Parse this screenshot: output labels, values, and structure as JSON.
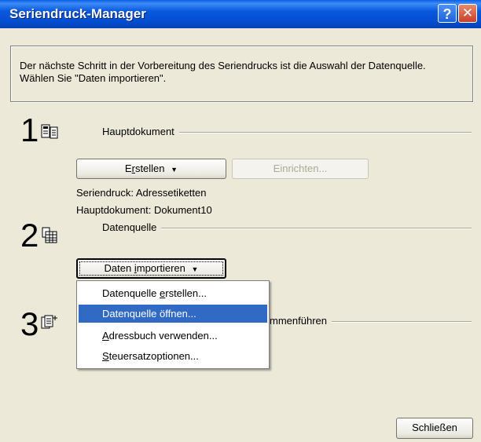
{
  "window": {
    "title": "Seriendruck-Manager",
    "help_glyph": "?",
    "close_glyph": "✕"
  },
  "instructions": "Der nächste Schritt in der Vorbereitung des Seriendrucks ist die Auswahl der Datenquelle. Wählen Sie \"Daten importieren\".",
  "steps": [
    {
      "number": "1",
      "icon": "main-document-icon",
      "label": "Hauptdokument"
    },
    {
      "number": "2",
      "icon": "data-source-icon",
      "label": "Datenquelle"
    },
    {
      "number": "3",
      "icon": "merge-icon",
      "label_partial": "mmenführen"
    }
  ],
  "step1": {
    "create_button": {
      "pre": "E",
      "accel": "r",
      "post": "stellen",
      "arrow": "▼"
    },
    "setup_button": "Einrichten...",
    "info_line1": "Seriendruck: Adressetiketten",
    "info_line2": "Hauptdokument: Dokument10"
  },
  "step2": {
    "import_button": {
      "pre": "Daten ",
      "accel": "i",
      "post": "mportieren",
      "arrow": "▼"
    }
  },
  "menu": {
    "items": [
      {
        "pre": "Datenquelle ",
        "accel": "e",
        "post": "rstellen...",
        "selected": false
      },
      {
        "pre": "Datenquelle ",
        "accel": "ö",
        "post": "ffnen...",
        "selected": true
      },
      {
        "pre": "",
        "accel": "A",
        "post": "dressbuch verwenden...",
        "selected": false
      },
      {
        "pre": "",
        "accel": "S",
        "post": "teuersatzoptionen...",
        "selected": false
      }
    ]
  },
  "close_button": "Schließen",
  "colors": {
    "titlebar": "#0550d4",
    "selection": "#316ac5",
    "dialog_bg": "#ece9d8"
  }
}
